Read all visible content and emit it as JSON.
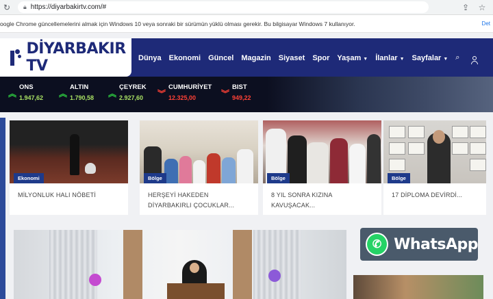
{
  "browser": {
    "url": "https://diyarbakirtv.com/#",
    "info_message": "oogle Chrome güncellemelerini almak için Windows 10 veya sonraki bir sürümün yüklü olması gerekir. Bu bilgisayar Windows 7 kullanıyor.",
    "info_link": "Det"
  },
  "site": {
    "logo_text": "DİYARBAKIR TV",
    "nav": [
      {
        "label": "Dünya"
      },
      {
        "label": "Ekonomi"
      },
      {
        "label": "Güncel"
      },
      {
        "label": "Magazin"
      },
      {
        "label": "Siyaset"
      },
      {
        "label": "Spor"
      },
      {
        "label": "Yaşam",
        "dropdown": true
      },
      {
        "label": "İlanlar",
        "dropdown": true
      },
      {
        "label": "Sayfalar",
        "dropdown": true
      }
    ]
  },
  "ticker": [
    {
      "name": "ONS",
      "value": "1.947,62",
      "trend": "up"
    },
    {
      "name": "ALTIN",
      "value": "1.790,58",
      "trend": "up"
    },
    {
      "name": "ÇEYREK",
      "value": "2.927,60",
      "trend": "up"
    },
    {
      "name": "CUMHURİYET",
      "value": "12.325,00",
      "trend": "down"
    },
    {
      "name": "BIST",
      "value": "949,22",
      "trend": "down"
    }
  ],
  "news": [
    {
      "category": "Ekonomi",
      "title": "MİLYONLUK HALI NÖBETİ"
    },
    {
      "category": "Bölge",
      "title": "HERŞEYİ HAKEDEN DİYARBAKIRLI ÇOCUKLAR..."
    },
    {
      "category": "Bölge",
      "title": "8 YIL SONRA KIZINA KAVUŞACAK..."
    },
    {
      "category": "Bölge",
      "title": "17 DİPLOMA DEVİRDİ..."
    }
  ],
  "whatsapp": {
    "label": "WhatsApp"
  },
  "colors": {
    "brand": "#1e2a78",
    "badge": "#1e3a8a",
    "up": "#2ecc40",
    "down": "#ff4136",
    "whatsapp": "#25d366"
  }
}
